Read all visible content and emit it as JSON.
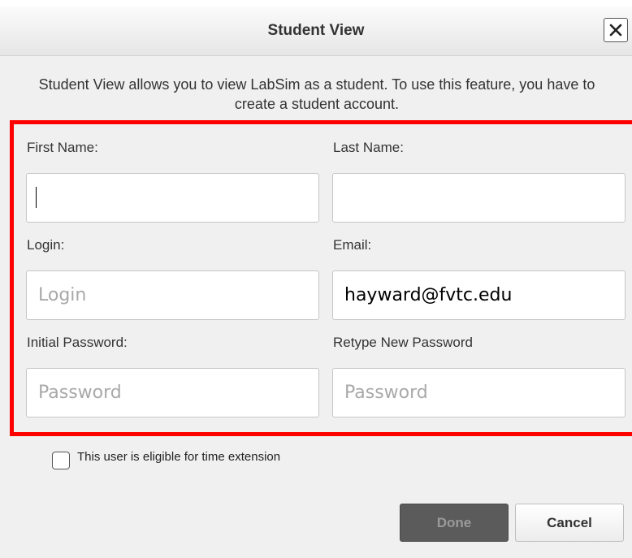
{
  "dialog": {
    "title": "Student View",
    "description": "Student View allows you to view LabSim as a student. To use this feature, you have to create a student account."
  },
  "form": {
    "first_name": {
      "label": "First Name:",
      "value": "",
      "placeholder": ""
    },
    "last_name": {
      "label": "Last Name:",
      "value": "",
      "placeholder": ""
    },
    "login": {
      "label": "Login:",
      "value": "",
      "placeholder": "Login"
    },
    "email": {
      "label": "Email:",
      "value": "hayward@fvtc.edu",
      "placeholder": ""
    },
    "initial_password": {
      "label": "Initial Password:",
      "value": "",
      "placeholder": "Password"
    },
    "retype_password": {
      "label": "Retype New Password",
      "value": "",
      "placeholder": "Password"
    }
  },
  "time_extension": {
    "label": "This user is eligible for time extension",
    "checked": false
  },
  "buttons": {
    "done_label": "Done",
    "cancel_label": "Cancel"
  },
  "colors": {
    "highlight": "#ff0000",
    "done_button_bg": "#5b5b5b",
    "dialog_bg": "#f0f0f0"
  },
  "icons": {
    "close": "close-icon"
  }
}
